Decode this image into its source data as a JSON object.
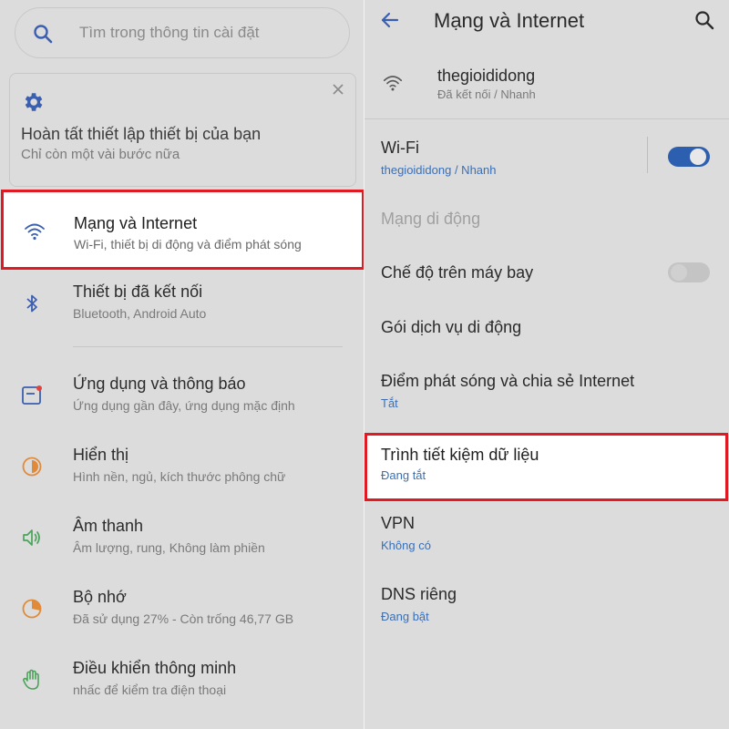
{
  "left": {
    "search": {
      "placeholder": "Tìm trong thông tin cài đặt",
      "icon": "search-icon"
    },
    "setup_card": {
      "title": "Hoàn tất thiết lập thiết bị của bạn",
      "subtitle": "Chỉ còn một vài bước nữa",
      "icon": "gear-icon",
      "close_icon": "close-icon"
    },
    "items": [
      {
        "title": "Mạng và Internet",
        "subtitle": "Wi-Fi, thiết bị di động và điểm phát sóng",
        "icon": "wifi-icon",
        "highlighted": true
      },
      {
        "title": "Thiết bị đã kết nối",
        "subtitle": "Bluetooth, Android Auto",
        "icon": "bluetooth-icon"
      },
      {
        "title": "Ứng dụng và thông báo",
        "subtitle": "Ứng dụng gần đây, ứng dụng mặc định",
        "icon": "apps-icon"
      },
      {
        "title": "Hiển thị",
        "subtitle": "Hình nền, ngủ, kích thước phông chữ",
        "icon": "brightness-icon"
      },
      {
        "title": "Âm thanh",
        "subtitle": "Âm lượng, rung, Không làm phiền",
        "icon": "volume-icon"
      },
      {
        "title": "Bộ nhớ",
        "subtitle": "Đã sử dụng 27% - Còn trống 46,77 GB",
        "icon": "storage-icon"
      },
      {
        "title": "Điều khiển thông minh",
        "subtitle": "nhấc để kiểm tra điện thoại",
        "icon": "gesture-hand-icon"
      }
    ]
  },
  "right": {
    "title": "Mạng và Internet",
    "back_icon": "back-arrow-icon",
    "search_icon": "search-icon",
    "connection": {
      "ssid": "thegioididong",
      "status": "Đã kết nối / Nhanh",
      "icon": "wifi-icon"
    },
    "wifi": {
      "title": "Wi-Fi",
      "subtitle": "thegioididong / Nhanh",
      "toggle": "on"
    },
    "mobile": {
      "title": "Mạng di động"
    },
    "airplane": {
      "title": "Chế độ trên máy bay",
      "toggle": "off"
    },
    "plan": {
      "title": "Gói dịch vụ di động"
    },
    "hotspot": {
      "title": "Điểm phát sóng và chia sẻ Internet",
      "subtitle": "Tắt"
    },
    "datasaver": {
      "title": "Trình tiết kiệm dữ liệu",
      "subtitle": "Đang tắt",
      "highlighted": true
    },
    "vpn": {
      "title": "VPN",
      "subtitle": "Không có"
    },
    "dns": {
      "title": "DNS riêng",
      "subtitle": "Đang bật"
    }
  },
  "colors": {
    "accent": "#3b6fb6",
    "highlight_border": "#e01a22",
    "background": "#dcdcdc",
    "toggle_on": "#2d5fb0"
  }
}
